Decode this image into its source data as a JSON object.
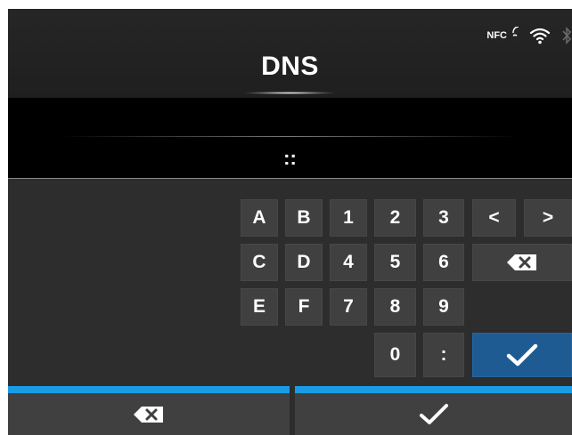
{
  "header": {
    "title": "DNS",
    "status": {
      "nfc_label": "NFC",
      "icons": [
        "nfc-icon",
        "wifi-icon",
        "bluetooth-icon"
      ]
    }
  },
  "input": {
    "value": "::"
  },
  "keypad": {
    "row1": [
      "A",
      "B",
      "1",
      "2",
      "3"
    ],
    "row2": [
      "C",
      "D",
      "4",
      "5",
      "6"
    ],
    "row3": [
      "E",
      "F",
      "7",
      "8",
      "9"
    ],
    "row4": [
      "0",
      ":"
    ],
    "cursor_left_label": "<",
    "cursor_right_label": ">",
    "backspace_icon": "backspace-icon",
    "confirm_icon": "checkmark-icon"
  },
  "bottom_bar": {
    "left_icon": "backspace-icon",
    "right_icon": "checkmark-icon"
  },
  "colors": {
    "background": "#2d2d2d",
    "field": "#000000",
    "key": "#404040",
    "confirm_key": "#1f5b93",
    "accent": "#1a9be6",
    "text": "#ffffff"
  }
}
